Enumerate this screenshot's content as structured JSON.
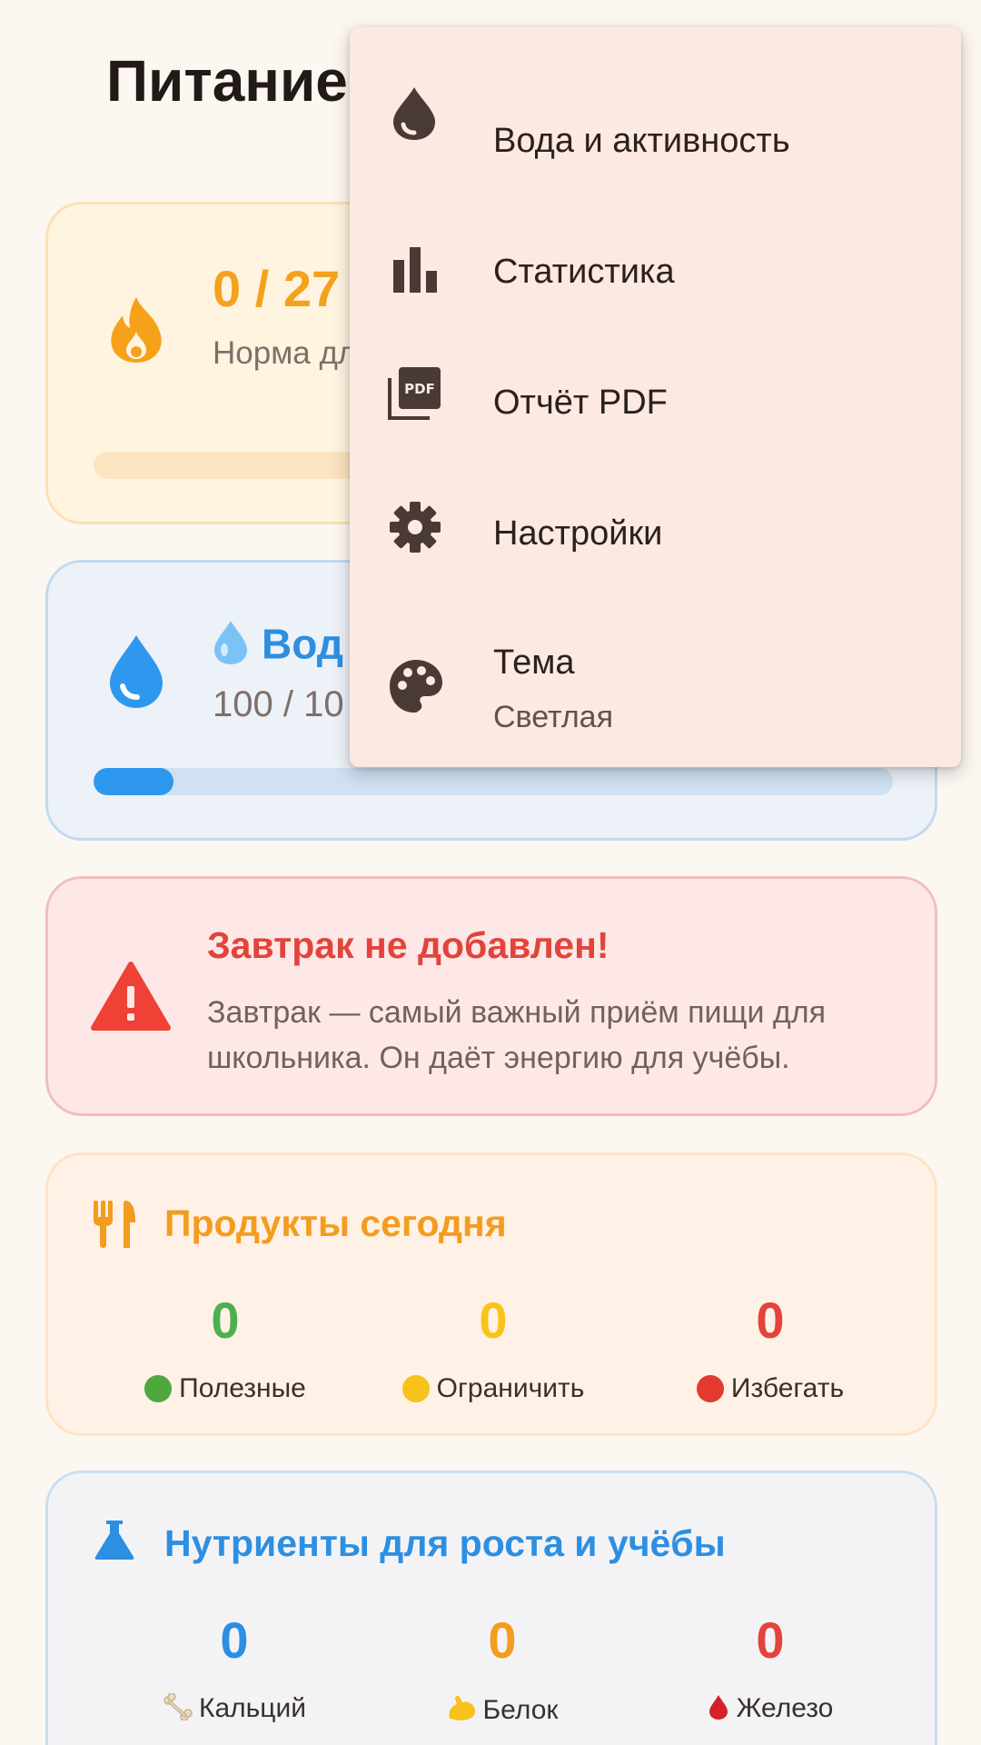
{
  "page": {
    "title": "Питание"
  },
  "calories": {
    "value": "0 / 27",
    "description": "Норма дл тренирово",
    "progress_fraction": 0.0,
    "accent": "#f4a21c"
  },
  "water": {
    "icon": "water-drop-icon",
    "title": "Вод",
    "value": "100 / 10",
    "progress_fraction": 0.1,
    "accent": "#2e98ee"
  },
  "breakfast_alert": {
    "icon": "warning-icon",
    "title": "Завтрак не добавлен!",
    "text": "Завтрак — самый важный приём пищи для школьника. Он даёт энергию для учёбы.",
    "accent": "#e2443b"
  },
  "products": {
    "icon": "cutlery-icon",
    "title": "Продукты сегодня",
    "stats": [
      {
        "value": "0",
        "label": "Полезные",
        "color": "#4caf50"
      },
      {
        "value": "0",
        "label": "Ограничить",
        "color": "#f9c31b"
      },
      {
        "value": "0",
        "label": "Избегать",
        "color": "#e2443b"
      }
    ]
  },
  "nutrients": {
    "icon": "flask-icon",
    "title": "Нутриенты для роста и учёбы",
    "stats": [
      {
        "value": "0",
        "label": "Кальций",
        "icon": "bone-icon",
        "color": "#2c8fe2"
      },
      {
        "value": "0",
        "label": "Белок",
        "icon": "flexed-biceps-icon",
        "color": "#f39c1e"
      },
      {
        "value": "0",
        "label": "Железо",
        "icon": "blood-drop-icon",
        "color": "#e2443b"
      }
    ]
  },
  "menu": {
    "items": [
      {
        "label": "Вода и активность",
        "icon": "water-drop-icon"
      },
      {
        "label": "Статистика",
        "icon": "bar-chart-icon"
      },
      {
        "label": "Отчёт PDF",
        "icon": "pdf-icon"
      },
      {
        "label": "Настройки",
        "icon": "gear-icon"
      },
      {
        "label": "Тема",
        "sublabel": "Светлая",
        "icon": "palette-icon"
      }
    ]
  }
}
